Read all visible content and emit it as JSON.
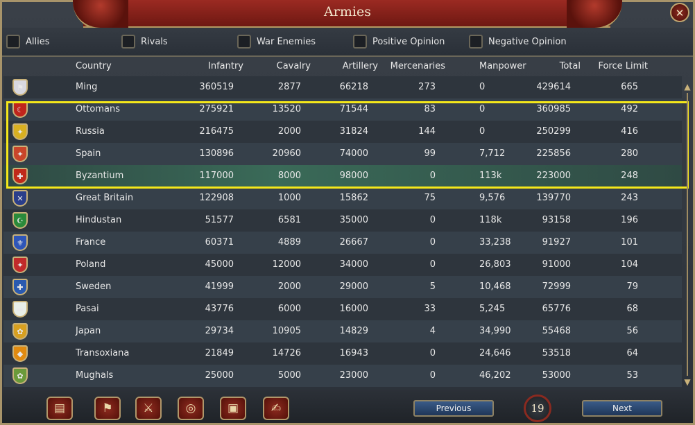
{
  "window": {
    "title": "Armies",
    "close_label": "✕"
  },
  "filters": [
    {
      "label": "Allies",
      "checked": false
    },
    {
      "label": "Rivals",
      "checked": false
    },
    {
      "label": "War Enemies",
      "checked": false
    },
    {
      "label": "Positive Opinion",
      "checked": false
    },
    {
      "label": "Negative Opinion",
      "checked": false
    }
  ],
  "columns": {
    "country": "Country",
    "infantry": "Infantry",
    "cavalry": "Cavalry",
    "artillery": "Artillery",
    "mercenaries": "Mercenaries",
    "manpower": "Manpower",
    "total": "Total",
    "force_limit": "Force Limit"
  },
  "rows": [
    {
      "country": "Ming",
      "infantry": "360519",
      "cavalry": "2877",
      "artillery": "66218",
      "mercenaries": "273",
      "manpower": "0",
      "total": "429614",
      "force_limit": "665",
      "flag_color": "#d8d8e0",
      "flag_icon": "⚑"
    },
    {
      "country": "Ottomans",
      "infantry": "275921",
      "cavalry": "13520",
      "artillery": "71544",
      "mercenaries": "83",
      "manpower": "0",
      "total": "360985",
      "force_limit": "492",
      "flag_color": "#c0251c",
      "flag_icon": "☾"
    },
    {
      "country": "Russia",
      "infantry": "216475",
      "cavalry": "2000",
      "artillery": "31824",
      "mercenaries": "144",
      "manpower": "0",
      "total": "250299",
      "force_limit": "416",
      "flag_color": "#d9b021",
      "flag_icon": "✦"
    },
    {
      "country": "Spain",
      "infantry": "130896",
      "cavalry": "20960",
      "artillery": "74000",
      "mercenaries": "99",
      "manpower": "7,712",
      "total": "225856",
      "force_limit": "280",
      "flag_color": "#c8452a",
      "flag_icon": "✦"
    },
    {
      "country": "Byzantium",
      "infantry": "117000",
      "cavalry": "8000",
      "artillery": "98000",
      "mercenaries": "0",
      "manpower": "113k",
      "total": "223000",
      "force_limit": "248",
      "flag_color": "#c02a1a",
      "flag_icon": "✚"
    },
    {
      "country": "Great Britain",
      "infantry": "122908",
      "cavalry": "1000",
      "artillery": "15862",
      "mercenaries": "75",
      "manpower": "9,576",
      "total": "139770",
      "force_limit": "243",
      "flag_color": "#2a3e8a",
      "flag_icon": "✕"
    },
    {
      "country": "Hindustan",
      "infantry": "51577",
      "cavalry": "6581",
      "artillery": "35000",
      "mercenaries": "0",
      "manpower": "118k",
      "total": "93158",
      "force_limit": "196",
      "flag_color": "#2a8a3a",
      "flag_icon": "☪"
    },
    {
      "country": "France",
      "infantry": "60371",
      "cavalry": "4889",
      "artillery": "26667",
      "mercenaries": "0",
      "manpower": "33,238",
      "total": "91927",
      "force_limit": "101",
      "flag_color": "#2f56b8",
      "flag_icon": "⚜"
    },
    {
      "country": "Poland",
      "infantry": "45000",
      "cavalry": "12000",
      "artillery": "34000",
      "mercenaries": "0",
      "manpower": "26,803",
      "total": "91000",
      "force_limit": "104",
      "flag_color": "#c02a2a",
      "flag_icon": "✦"
    },
    {
      "country": "Sweden",
      "infantry": "41999",
      "cavalry": "2000",
      "artillery": "29000",
      "mercenaries": "5",
      "manpower": "10,468",
      "total": "72999",
      "force_limit": "79",
      "flag_color": "#2a5ab0",
      "flag_icon": "✚"
    },
    {
      "country": "Pasai",
      "infantry": "43776",
      "cavalry": "6000",
      "artillery": "16000",
      "mercenaries": "33",
      "manpower": "5,245",
      "total": "65776",
      "force_limit": "68",
      "flag_color": "#e8eee8",
      "flag_icon": "▬"
    },
    {
      "country": "Japan",
      "infantry": "29734",
      "cavalry": "10905",
      "artillery": "14829",
      "mercenaries": "4",
      "manpower": "34,990",
      "total": "55468",
      "force_limit": "56",
      "flag_color": "#d8a020",
      "flag_icon": "✿"
    },
    {
      "country": "Transoxiana",
      "infantry": "21849",
      "cavalry": "14726",
      "artillery": "16943",
      "mercenaries": "0",
      "manpower": "24,646",
      "total": "53518",
      "force_limit": "64",
      "flag_color": "#e08a10",
      "flag_icon": "◆"
    },
    {
      "country": "Mughals",
      "infantry": "25000",
      "cavalry": "5000",
      "artillery": "23000",
      "mercenaries": "0",
      "manpower": "46,202",
      "total": "53000",
      "force_limit": "53",
      "flag_color": "#6a9a3a",
      "flag_icon": "✿"
    }
  ],
  "highlighted_rows": [
    "Ottomans",
    "Russia",
    "Spain",
    "Byzantium"
  ],
  "selected_row": "Byzantium",
  "highlight_color": "#f5e81a",
  "bottom_icons": [
    {
      "name": "ledger-icon",
      "glyph": "▤"
    },
    {
      "name": "flag-icon",
      "glyph": "⚑"
    },
    {
      "name": "crossed-swords-icon",
      "glyph": "⚔"
    },
    {
      "name": "coins-icon",
      "glyph": "◎"
    },
    {
      "name": "crate-icon",
      "glyph": "▣"
    },
    {
      "name": "handshake-icon",
      "glyph": "✍"
    }
  ],
  "pagination": {
    "previous_label": "Previous",
    "page": "19",
    "next_label": "Next"
  },
  "scroll": {
    "up": "▲",
    "down": "▼"
  }
}
